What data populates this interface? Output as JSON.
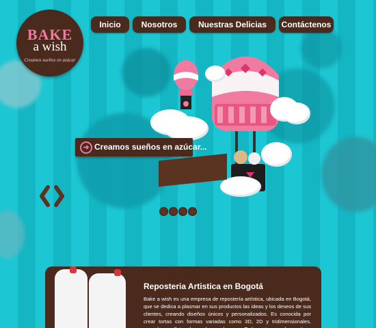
{
  "logo": {
    "line1": "BAKE",
    "line2": "a wish",
    "tagline": "Creamos sueños en azúcar"
  },
  "nav": {
    "items": [
      {
        "label": "Inicio"
      },
      {
        "label": "Nosotros"
      },
      {
        "label": "Nuestras Delicias"
      },
      {
        "label": "Contáctenos"
      }
    ]
  },
  "slider": {
    "caption": "Creamos sueños en azúcar...",
    "arrow_icon": "circle-arrow-right-icon",
    "prev_icon": "chevron-left-icon",
    "next_icon": "chevron-right-icon",
    "dots": 4
  },
  "content": {
    "heading": "Reposteria Artistica en Bogotá",
    "body": "Bake a wish es una empresa de repostería artística, ubicada en Bogotá, que se dedica a plasmar en sus productos las ideas y los deseos de sus clientes, creando diseños únicos y personalizados. Es conocida por crear tortas con formas variadas como 3D, 2D y tridimensionales, cupcakes, galletas decoradas y cake pops. Todos estos, con los motivos y sabores de"
  },
  "colors": {
    "brown": "#4a2a1c",
    "pink": "#ee7ba3",
    "teal": "#1cc6d2"
  }
}
